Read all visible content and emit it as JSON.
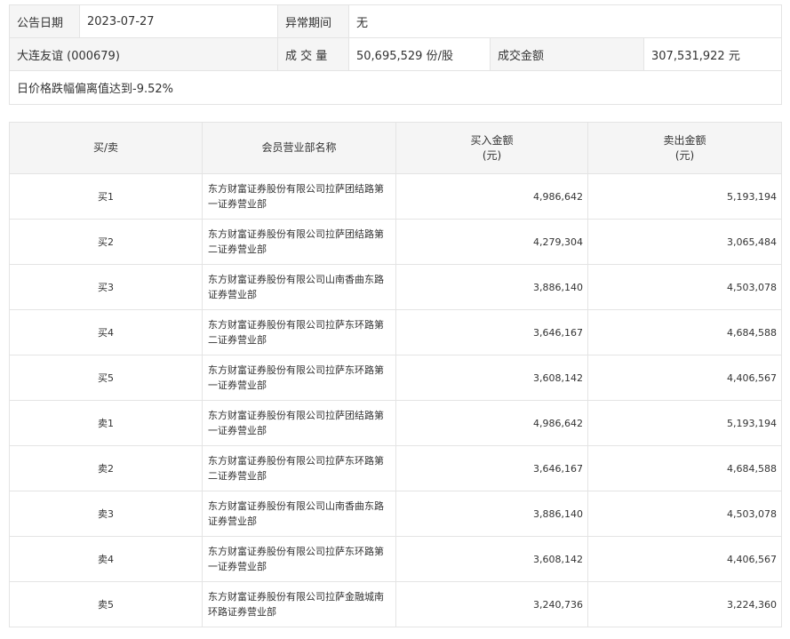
{
  "info": {
    "date_label": "公告日期",
    "date_value": "2023-07-27",
    "period_label": "异常期间",
    "period_value": "无",
    "stock_name": "大连友谊 (000679)",
    "volume_label": "成 交 量",
    "volume_value": "50,695,529 份/股",
    "amount_label": "成交金额",
    "amount_value": "307,531,922 元",
    "reason": "日价格跌幅偏离值达到-9.52%"
  },
  "table": {
    "headers": {
      "direction": "买/卖",
      "branch": "会员营业部名称",
      "buy_amount": "买入金额",
      "buy_unit": "(元)",
      "sell_amount": "卖出金额",
      "sell_unit": "(元)"
    },
    "rows": [
      {
        "direction": "买1",
        "branch": "东方财富证券股份有限公司拉萨团结路第一证券营业部",
        "buy": "4,986,642",
        "sell": "5,193,194"
      },
      {
        "direction": "买2",
        "branch": "东方财富证券股份有限公司拉萨团结路第二证券营业部",
        "buy": "4,279,304",
        "sell": "3,065,484"
      },
      {
        "direction": "买3",
        "branch": "东方财富证券股份有限公司山南香曲东路证券营业部",
        "buy": "3,886,140",
        "sell": "4,503,078"
      },
      {
        "direction": "买4",
        "branch": "东方财富证券股份有限公司拉萨东环路第二证券营业部",
        "buy": "3,646,167",
        "sell": "4,684,588"
      },
      {
        "direction": "买5",
        "branch": "东方财富证券股份有限公司拉萨东环路第一证券营业部",
        "buy": "3,608,142",
        "sell": "4,406,567"
      },
      {
        "direction": "卖1",
        "branch": "东方财富证券股份有限公司拉萨团结路第一证券营业部",
        "buy": "4,986,642",
        "sell": "5,193,194"
      },
      {
        "direction": "卖2",
        "branch": "东方财富证券股份有限公司拉萨东环路第二证券营业部",
        "buy": "3,646,167",
        "sell": "4,684,588"
      },
      {
        "direction": "卖3",
        "branch": "东方财富证券股份有限公司山南香曲东路证券营业部",
        "buy": "3,886,140",
        "sell": "4,503,078"
      },
      {
        "direction": "卖4",
        "branch": "东方财富证券股份有限公司拉萨东环路第一证券营业部",
        "buy": "3,608,142",
        "sell": "4,406,567"
      },
      {
        "direction": "卖5",
        "branch": "东方财富证券股份有限公司拉萨金融城南环路证券营业部",
        "buy": "3,240,736",
        "sell": "3,224,360"
      }
    ]
  }
}
